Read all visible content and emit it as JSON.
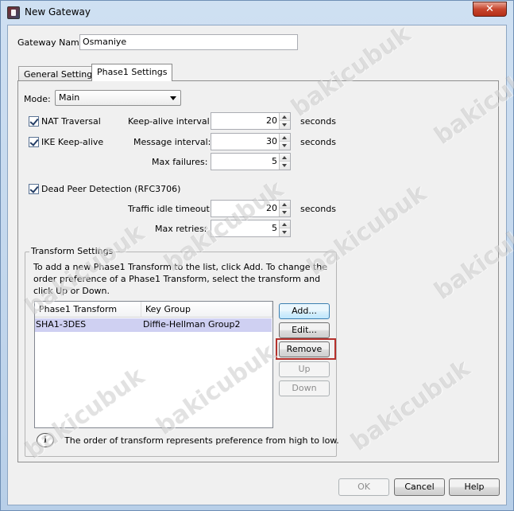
{
  "window": {
    "title": "New Gateway",
    "close_glyph": "✕"
  },
  "gateway_name": {
    "label": "Gateway Name:",
    "value": "Osmaniye"
  },
  "tabs": [
    {
      "label": "General Settings",
      "active": false
    },
    {
      "label": "Phase1 Settings",
      "active": true
    }
  ],
  "mode": {
    "label": "Mode:",
    "value": "Main"
  },
  "nat_traversal": {
    "label": "NAT Traversal",
    "checked": true
  },
  "ike_keepalive": {
    "label": "IKE Keep-alive",
    "checked": true
  },
  "keepalive_interval": {
    "label": "Keep-alive interval:",
    "value": "20",
    "unit": "seconds"
  },
  "message_interval": {
    "label": "Message interval:",
    "value": "30",
    "unit": "seconds"
  },
  "max_failures": {
    "label": "Max failures:",
    "value": "5"
  },
  "dead_peer": {
    "label": "Dead Peer Detection (RFC3706)",
    "checked": true
  },
  "traffic_idle_timeout": {
    "label": "Traffic idle timeout:",
    "value": "20",
    "unit": "seconds"
  },
  "max_retries": {
    "label": "Max retries:",
    "value": "5"
  },
  "transform_settings": {
    "title": "Transform Settings",
    "description": "To add a new Phase1 Transform to the list, click Add. To change the order preference of a Phase1 Transform, select the transform and click Up or Down.",
    "columns": [
      "Phase1 Transform",
      "Key Group"
    ],
    "rows": [
      {
        "transform": "SHA1-3DES",
        "key_group": "Diffie-Hellman Group2"
      }
    ],
    "buttons": {
      "add": "Add...",
      "edit": "Edit...",
      "remove": "Remove",
      "up": "Up",
      "down": "Down"
    },
    "info": "The order of transform represents preference from high to low."
  },
  "footer": {
    "ok": "OK",
    "cancel": "Cancel",
    "help": "Help"
  },
  "watermark": "bakicubuk",
  "colors": {
    "highlight": "#b5312c",
    "selected_row": "#cfd0f2"
  }
}
